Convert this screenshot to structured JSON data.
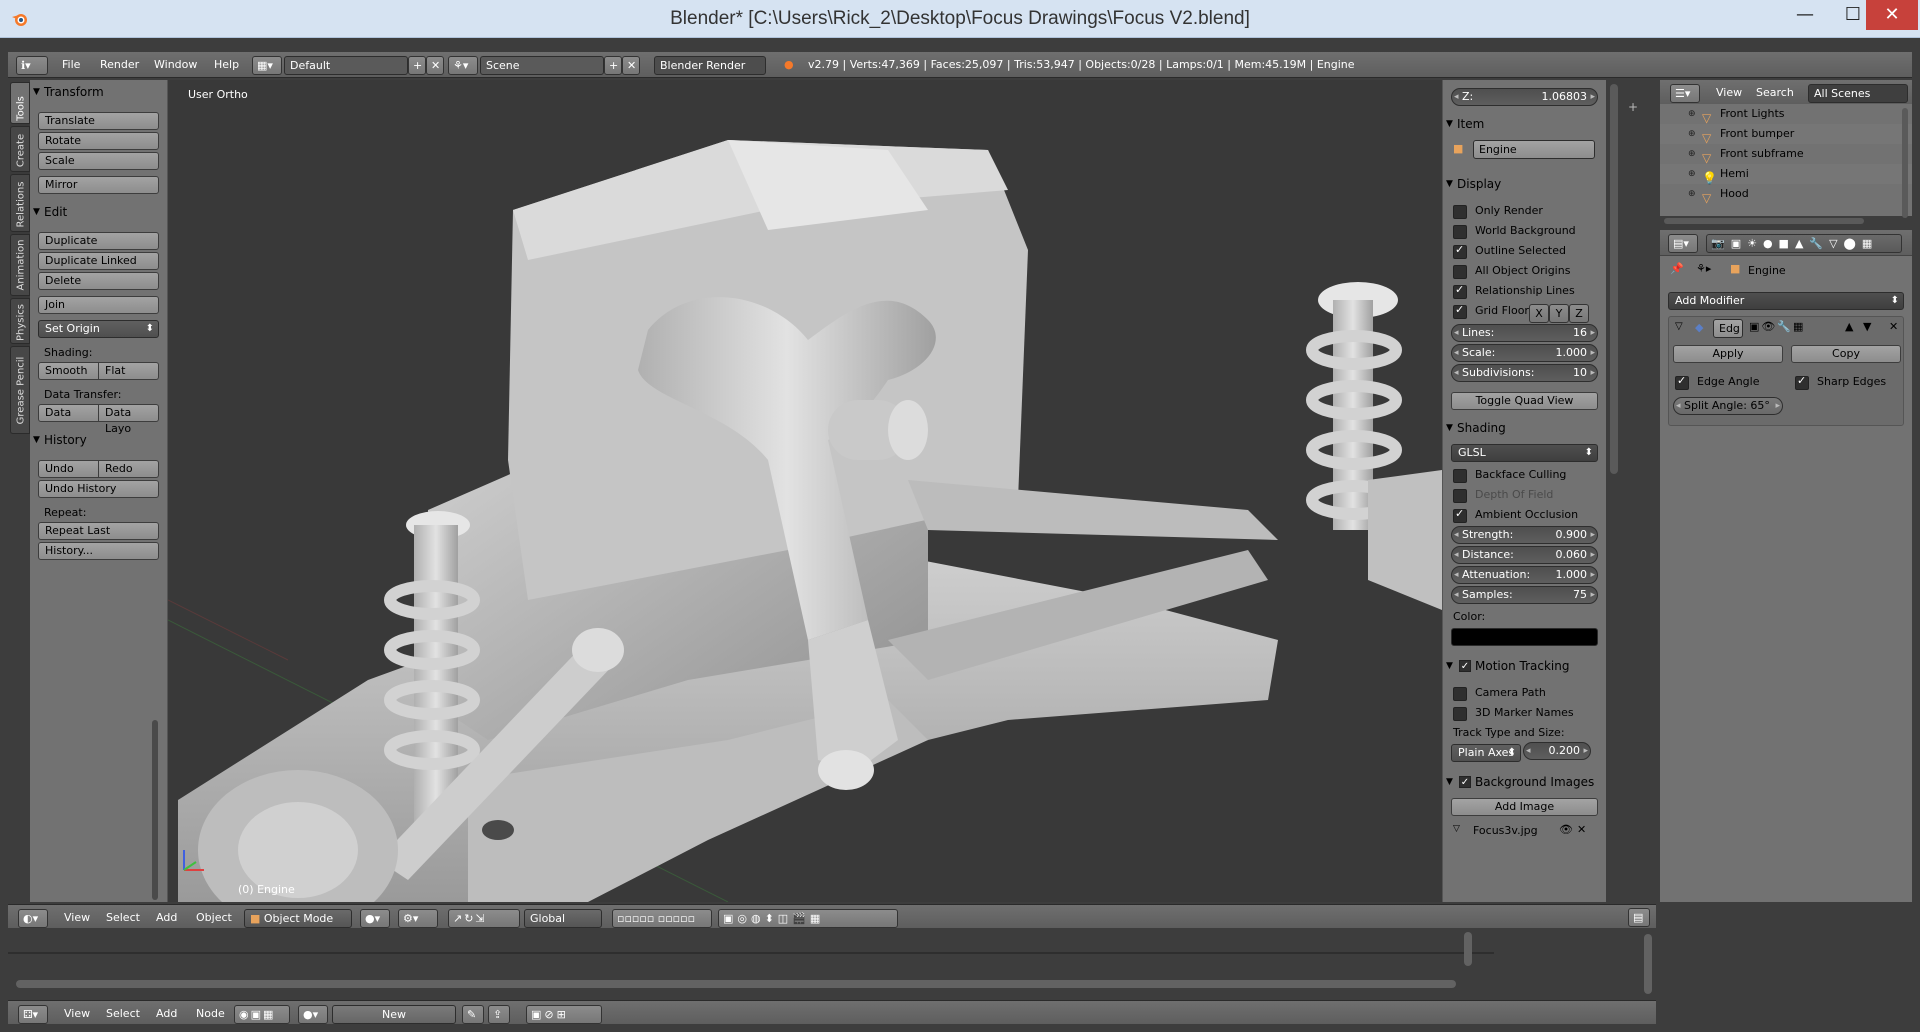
{
  "window": {
    "title": "Blender* [C:\\Users\\Rick_2\\Desktop\\Focus Drawings\\Focus V2.blend]",
    "minimize": "—",
    "maximize": "☐",
    "close": "✕"
  },
  "info_header": {
    "menus": [
      "File",
      "Render",
      "Window",
      "Help"
    ],
    "layout": "Default",
    "scene": "Scene",
    "engine": "Blender Render",
    "stats": "v2.79 | Verts:47,369 | Faces:25,097 | Tris:53,947 | Objects:0/28 | Lamps:0/1 | Mem:45.19M | Engine"
  },
  "tool_tabs": [
    "Tools",
    "Create",
    "Relations",
    "Animation",
    "Physics",
    "Grease Pencil"
  ],
  "tool_shelf": {
    "transform": {
      "title": "Transform",
      "buttons": [
        "Translate",
        "Rotate",
        "Scale",
        "Mirror"
      ]
    },
    "edit": {
      "title": "Edit",
      "buttons": [
        "Duplicate",
        "Duplicate Linked",
        "Delete",
        "Join"
      ],
      "set_origin": "Set Origin",
      "shading_label": "Shading:",
      "smooth": "Smooth",
      "flat": "Flat",
      "data_transfer_label": "Data Transfer:",
      "data": "Data",
      "data_layout": "Data Layo"
    },
    "history": {
      "title": "History",
      "undo": "Undo",
      "redo": "Redo",
      "undo_history": "Undo History",
      "repeat_label": "Repeat:",
      "repeat_last": "Repeat Last",
      "history_btn": "History..."
    }
  },
  "viewport": {
    "view_label": "User Ortho",
    "object_label": "(0) Engine",
    "axes": {
      "x": "x",
      "y": "y",
      "z": "z"
    }
  },
  "n_panel": {
    "z_label": "Z:",
    "z_value": "1.06803",
    "item": {
      "title": "Item",
      "name": "Engine"
    },
    "display": {
      "title": "Display",
      "only_render": "Only Render",
      "world_background": "World Background",
      "outline_selected": "Outline Selected",
      "all_object_origins": "All Object Origins",
      "relationship_lines": "Relationship Lines",
      "grid_floor": "Grid Floor",
      "x": "X",
      "y": "Y",
      "z": "Z",
      "lines_label": "Lines:",
      "lines_value": "16",
      "scale_label": "Scale:",
      "scale_value": "1.000",
      "subdiv_label": "Subdivisions:",
      "subdiv_value": "10",
      "toggle_quad": "Toggle Quad View"
    },
    "shading": {
      "title": "Shading",
      "mode": "GLSL",
      "backface_culling": "Backface Culling",
      "depth_of_field": "Depth Of Field",
      "ambient_occlusion": "Ambient Occlusion",
      "strength_label": "Strength:",
      "strength_value": "0.900",
      "distance_label": "Distance:",
      "distance_value": "0.060",
      "attenuation_label": "Attenuation:",
      "attenuation_value": "1.000",
      "samples_label": "Samples:",
      "samples_value": "75",
      "color_label": "Color:",
      "color": "#000000"
    },
    "motion_tracking": {
      "title": "Motion Tracking",
      "camera_path": "Camera Path",
      "marker_names": "3D Marker Names",
      "track_label": "Track Type and Size:",
      "track_type": "Plain Axes",
      "track_size": "0.200"
    },
    "background_images": {
      "title": "Background Images",
      "add_image": "Add Image",
      "image_name": "Focus3v.jpg"
    }
  },
  "outliner": {
    "view": "View",
    "search": "Search",
    "scenes": "All Scenes",
    "items": [
      "Front Lights",
      "Front bumper",
      "Front subframe",
      "Hemi",
      "Hood"
    ]
  },
  "properties": {
    "object_name": "Engine",
    "add_modifier": "Add Modifier",
    "modifier_name": "Edg",
    "apply": "Apply",
    "copy": "Copy",
    "edge_angle": "Edge Angle",
    "sharp_edges": "Sharp Edges",
    "split_angle": "Split Angle: 65°"
  },
  "view3d_header": {
    "menus": [
      "View",
      "Select",
      "Add",
      "Object"
    ],
    "mode": "Object Mode",
    "orientation": "Global"
  },
  "node_header": {
    "menus": [
      "View",
      "Select",
      "Add",
      "Node"
    ],
    "new": "New"
  }
}
